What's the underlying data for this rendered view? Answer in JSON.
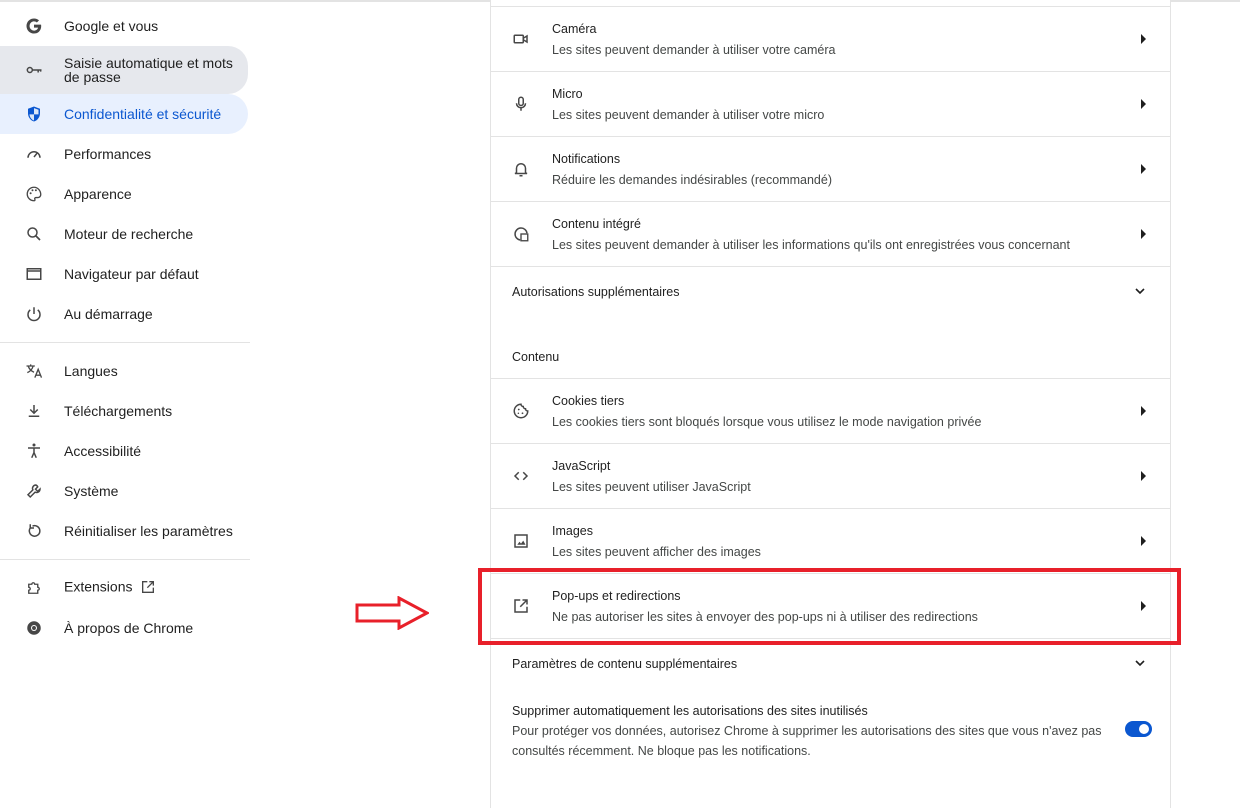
{
  "sidebar": {
    "items": [
      {
        "label": "Google et vous",
        "icon": "google-icon"
      },
      {
        "label": "Saisie automatique et mots de passe",
        "icon": "key-icon"
      },
      {
        "label": "Confidentialité et sécurité",
        "icon": "shield-icon"
      },
      {
        "label": "Performances",
        "icon": "speedometer-icon"
      },
      {
        "label": "Apparence",
        "icon": "palette-icon"
      },
      {
        "label": "Moteur de recherche",
        "icon": "search-icon"
      },
      {
        "label": "Navigateur par défaut",
        "icon": "browser-window-icon"
      },
      {
        "label": "Au démarrage",
        "icon": "power-icon"
      },
      {
        "label": "Langues",
        "icon": "translate-icon"
      },
      {
        "label": "Téléchargements",
        "icon": "download-icon"
      },
      {
        "label": "Accessibilité",
        "icon": "accessibility-icon"
      },
      {
        "label": "Système",
        "icon": "wrench-icon"
      },
      {
        "label": "Réinitialiser les paramètres",
        "icon": "reset-icon"
      },
      {
        "label": "Extensions",
        "icon": "puzzle-icon"
      },
      {
        "label": "À propos de Chrome",
        "icon": "chrome-icon"
      }
    ]
  },
  "permissions": [
    {
      "title": "Caméra",
      "subtitle": "Les sites peuvent demander à utiliser votre caméra",
      "icon": "camera-icon"
    },
    {
      "title": "Micro",
      "subtitle": "Les sites peuvent demander à utiliser votre micro",
      "icon": "microphone-icon"
    },
    {
      "title": "Notifications",
      "subtitle": "Réduire les demandes indésirables (recommandé)",
      "icon": "bell-icon"
    },
    {
      "title": "Contenu intégré",
      "subtitle": "Les sites peuvent demander à utiliser les informations qu'ils ont enregistrées vous concernant",
      "icon": "embedded-content-icon"
    }
  ],
  "additional_permissions_label": "Autorisations supplémentaires",
  "content_heading": "Contenu",
  "content": [
    {
      "title": "Cookies tiers",
      "subtitle": "Les cookies tiers sont bloqués lorsque vous utilisez le mode navigation privée",
      "icon": "cookie-icon"
    },
    {
      "title": "JavaScript",
      "subtitle": "Les sites peuvent utiliser JavaScript",
      "icon": "code-icon"
    },
    {
      "title": "Images",
      "subtitle": "Les sites peuvent afficher des images",
      "icon": "image-icon"
    },
    {
      "title": "Pop-ups et redirections",
      "subtitle": "Ne pas autoriser les sites à envoyer des pop-ups ni à utiliser des redirections",
      "icon": "open-in-new-icon"
    }
  ],
  "additional_content_label": "Paramètres de contenu supplémentaires",
  "auto_revoke": {
    "title": "Supprimer automatiquement les autorisations des sites inutilisés",
    "description": "Pour protéger vos données, autorisez Chrome à supprimer les autorisations des sites que vous n'avez pas consultés récemment. Ne bloque pas les notifications.",
    "enabled": true
  },
  "colors": {
    "accent": "#0b57d0",
    "active_bg": "#e8f0fe",
    "annotation": "#e8202a"
  }
}
